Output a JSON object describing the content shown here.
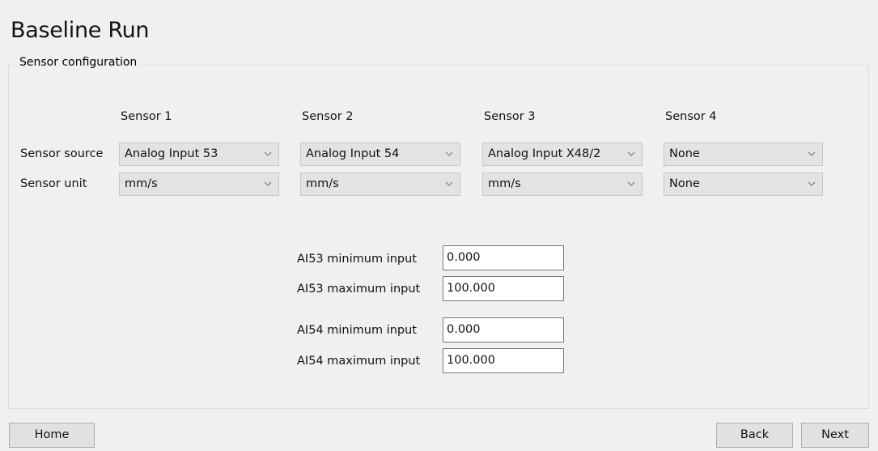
{
  "page": {
    "title": "Baseline Run"
  },
  "group": {
    "legend": "Sensor configuration"
  },
  "sensors": {
    "headers": [
      "Sensor 1",
      "Sensor 2",
      "Sensor 3",
      "Sensor 4"
    ],
    "row_labels": {
      "source": "Sensor source",
      "unit": "Sensor unit"
    },
    "sources": [
      "Analog Input 53",
      "Analog Input 54",
      "Analog Input X48/2",
      "None"
    ],
    "units": [
      "mm/s",
      "mm/s",
      "mm/s",
      "None"
    ]
  },
  "inputs": [
    {
      "label": "AI53 minimum input",
      "value": "0.000"
    },
    {
      "label": "AI53 maximum input",
      "value": "100.000"
    },
    {
      "label": "AI54 minimum input",
      "value": "0.000"
    },
    {
      "label": "AI54 maximum input",
      "value": "100.000"
    }
  ],
  "buttons": {
    "home": "Home",
    "back": "Back",
    "next": "Next"
  },
  "icons": {
    "dropdown": "chevron-down-icon"
  }
}
